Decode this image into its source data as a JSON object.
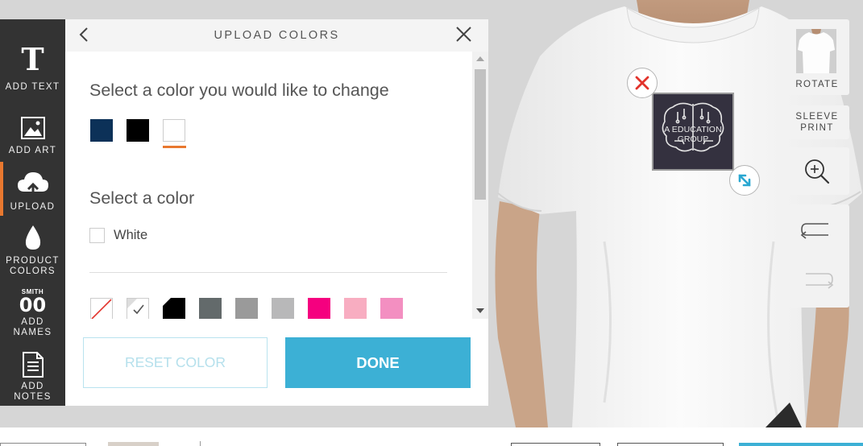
{
  "panel": {
    "title": "UPLOAD COLORS",
    "change_heading": "Select a color you would like to change",
    "select_heading": "Select a color",
    "current_color_label": "White",
    "logo_colors": [
      "#0c3158",
      "#000000",
      "#ffffff"
    ],
    "selected_logo_color_index": 2,
    "palette": [
      {
        "name": "none",
        "color": "#ffffff"
      },
      {
        "name": "white-checked",
        "color": "#ffffff"
      },
      {
        "name": "black",
        "color": "#000000"
      },
      {
        "name": "dark-gray",
        "color": "#636a6b"
      },
      {
        "name": "gray",
        "color": "#9a9a9a"
      },
      {
        "name": "light-gray",
        "color": "#b8b8b9"
      },
      {
        "name": "hot-pink",
        "color": "#f5007f"
      },
      {
        "name": "light-pink",
        "color": "#f8adc1"
      },
      {
        "name": "pink",
        "color": "#f38fc1"
      }
    ],
    "reset_label": "RESET COLOR",
    "done_label": "DONE"
  },
  "tools": [
    {
      "id": "add-text",
      "label_lines": [
        "ADD TEXT"
      ]
    },
    {
      "id": "add-art",
      "label_lines": [
        "ADD ART"
      ]
    },
    {
      "id": "upload",
      "label_lines": [
        "UPLOAD"
      ],
      "active": true
    },
    {
      "id": "product-colors",
      "label_lines": [
        "PRODUCT",
        "COLORS"
      ]
    },
    {
      "id": "add-names",
      "label_lines": [
        "ADD",
        "NAMES"
      ],
      "icon_text": "SMITH"
    },
    {
      "id": "add-notes",
      "label_lines": [
        "ADD",
        "NOTES"
      ]
    }
  ],
  "design": {
    "text_line1": "A EDUCATION",
    "text_line2": "GROUP"
  },
  "right_controls": {
    "rotate_label": "ROTATE",
    "sleeve_line1": "SLEEVE",
    "sleeve_line2": "PRINT"
  },
  "colors": {
    "accent_orange": "#e8782f",
    "primary_blue": "#3cb0d5",
    "rail_dark": "#333333"
  }
}
